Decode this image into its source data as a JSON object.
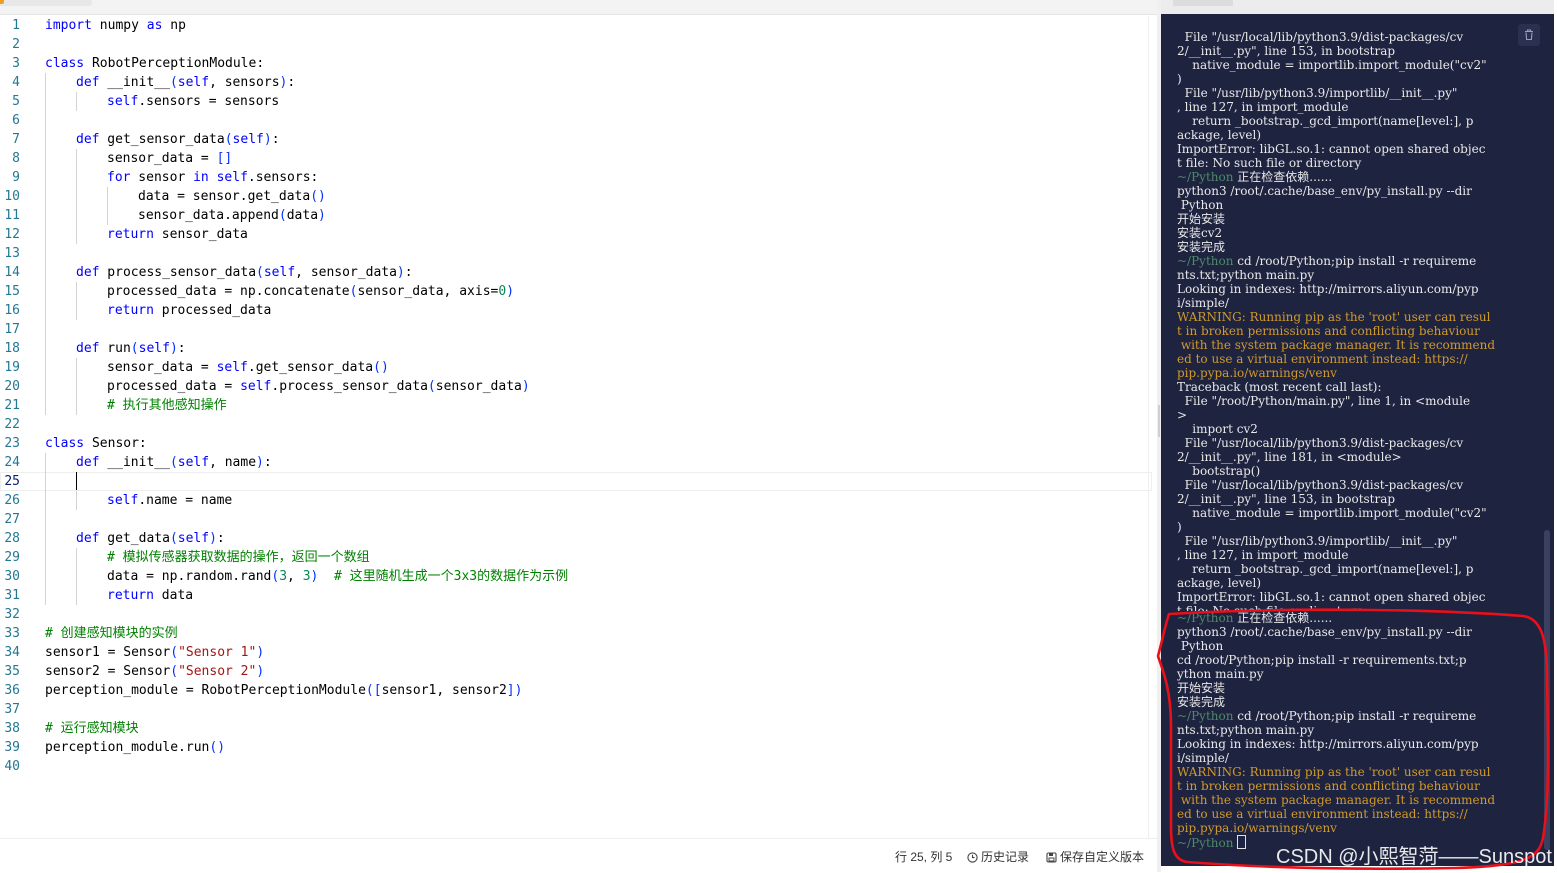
{
  "editor": {
    "cursor_line": 25,
    "lines": [
      {
        "n": "1",
        "indent": 0,
        "html": "<span class='kw'>import</span> numpy <span class='kw'>as</span> np"
      },
      {
        "n": "2",
        "indent": 0,
        "html": ""
      },
      {
        "n": "3",
        "indent": 0,
        "html": "<span class='kw'>class</span> RobotPerceptionModule:"
      },
      {
        "n": "4",
        "indent": 1,
        "html": "    <span class='kw'>def</span> __init__<span class='br'>(</span><span class='kw'>self</span>, sensors<span class='br'>)</span>:"
      },
      {
        "n": "5",
        "indent": 2,
        "html": "        <span class='kw'>self</span>.sensors = sensors"
      },
      {
        "n": "6",
        "indent": 1,
        "html": ""
      },
      {
        "n": "7",
        "indent": 1,
        "html": "    <span class='kw'>def</span> get_sensor_data<span class='br'>(</span><span class='kw'>self</span><span class='br'>)</span>:"
      },
      {
        "n": "8",
        "indent": 2,
        "html": "        sensor_data = <span class='br'>[]</span>"
      },
      {
        "n": "9",
        "indent": 2,
        "html": "        <span class='kw'>for</span> sensor <span class='kw'>in</span> <span class='kw'>self</span>.sensors:"
      },
      {
        "n": "10",
        "indent": 3,
        "html": "            data = sensor.get_data<span class='br'>()</span>"
      },
      {
        "n": "11",
        "indent": 3,
        "html": "            sensor_data.append<span class='br'>(</span>data<span class='br'>)</span>"
      },
      {
        "n": "12",
        "indent": 2,
        "html": "        <span class='kw'>return</span> sensor_data"
      },
      {
        "n": "13",
        "indent": 1,
        "html": ""
      },
      {
        "n": "14",
        "indent": 1,
        "html": "    <span class='kw'>def</span> process_sensor_data<span class='br'>(</span><span class='kw'>self</span>, sensor_data<span class='br'>)</span>:"
      },
      {
        "n": "15",
        "indent": 2,
        "html": "        processed_data = np.concatenate<span class='br'>(</span>sensor_data, axis=<span class='nm'>0</span><span class='br'>)</span>"
      },
      {
        "n": "16",
        "indent": 2,
        "html": "        <span class='kw'>return</span> processed_data"
      },
      {
        "n": "17",
        "indent": 1,
        "html": ""
      },
      {
        "n": "18",
        "indent": 1,
        "html": "    <span class='kw'>def</span> run<span class='br'>(</span><span class='kw'>self</span><span class='br'>)</span>:"
      },
      {
        "n": "19",
        "indent": 2,
        "html": "        sensor_data = <span class='kw'>self</span>.get_sensor_data<span class='br'>()</span>"
      },
      {
        "n": "20",
        "indent": 2,
        "html": "        processed_data = <span class='kw'>self</span>.process_sensor_data<span class='br'>(</span>sensor_data<span class='br'>)</span>"
      },
      {
        "n": "21",
        "indent": 2,
        "html": "        <span class='cm'># 执行其他感知操作</span>"
      },
      {
        "n": "22",
        "indent": 0,
        "html": ""
      },
      {
        "n": "23",
        "indent": 0,
        "html": "<span class='kw'>class</span> Sensor:"
      },
      {
        "n": "24",
        "indent": 1,
        "html": "    <span class='kw'>def</span> __init__<span class='br'>(</span><span class='kw'>self</span>, name<span class='br'>)</span>:"
      },
      {
        "n": "25",
        "indent": 1,
        "html": ""
      },
      {
        "n": "26",
        "indent": 2,
        "html": "        <span class='kw'>self</span>.name = name"
      },
      {
        "n": "27",
        "indent": 1,
        "html": ""
      },
      {
        "n": "28",
        "indent": 1,
        "html": "    <span class='kw'>def</span> get_data<span class='br'>(</span><span class='kw'>self</span><span class='br'>)</span>:"
      },
      {
        "n": "29",
        "indent": 2,
        "html": "        <span class='cm'># 模拟传感器获取数据的操作，返回一个数组</span>"
      },
      {
        "n": "30",
        "indent": 2,
        "html": "        data = np.random.rand<span class='br'>(</span><span class='nm'>3</span>, <span class='nm'>3</span><span class='br'>)</span>  <span class='cm'># 这里随机生成一个3x3的数据作为示例</span>"
      },
      {
        "n": "31",
        "indent": 2,
        "html": "        <span class='kw'>return</span> data"
      },
      {
        "n": "32",
        "indent": 0,
        "html": ""
      },
      {
        "n": "33",
        "indent": 0,
        "html": "<span class='cm'># 创建感知模块的实例</span>"
      },
      {
        "n": "34",
        "indent": 0,
        "html": "sensor1 = Sensor<span class='br'>(</span><span class='st'>\"Sensor 1\"</span><span class='br'>)</span>"
      },
      {
        "n": "35",
        "indent": 0,
        "html": "sensor2 = Sensor<span class='br'>(</span><span class='st'>\"Sensor 2\"</span><span class='br'>)</span>"
      },
      {
        "n": "36",
        "indent": 0,
        "html": "perception_module = RobotPerceptionModule<span class='br'>([</span>sensor1, sensor2<span class='br'>])</span>"
      },
      {
        "n": "37",
        "indent": 0,
        "html": ""
      },
      {
        "n": "38",
        "indent": 0,
        "html": "<span class='cm'># 运行感知模块</span>"
      },
      {
        "n": "39",
        "indent": 0,
        "html": "perception_module.run<span class='br'>()</span>"
      },
      {
        "n": "40",
        "indent": 0,
        "html": ""
      }
    ]
  },
  "status_bar": {
    "position": "行 25, 列 5",
    "history_label": "历史记录",
    "save_label": "保存自定义版本",
    "history_icon": "clock-icon",
    "save_icon": "save-icon"
  },
  "terminal": {
    "prompt": "~/Python",
    "lines": [
      {
        "t": "  File \"/usr/local/lib/python3.9/dist-packages/cv",
        "c": ""
      },
      {
        "t": "2/__init__.py\", line 153, in bootstrap",
        "c": ""
      },
      {
        "t": "    native_module = importlib.import_module(\"cv2\"",
        "c": ""
      },
      {
        "t": ")",
        "c": ""
      },
      {
        "t": "  File \"/usr/lib/python3.9/importlib/__init__.py\"",
        "c": ""
      },
      {
        "t": ", line 127, in import_module",
        "c": ""
      },
      {
        "t": "    return _bootstrap._gcd_import(name[level:], p",
        "c": ""
      },
      {
        "t": "ackage, level)",
        "c": ""
      },
      {
        "t": "ImportError: libGL.so.1: cannot open shared objec",
        "c": ""
      },
      {
        "t": "t file: No such file or directory",
        "c": ""
      },
      {
        "t": " 正在检查依赖......",
        "c": "prompt"
      },
      {
        "t": "python3 /root/.cache/base_env/py_install.py --dir",
        "c": ""
      },
      {
        "t": " Python",
        "c": ""
      },
      {
        "t": "开始安装",
        "c": ""
      },
      {
        "t": "安装cv2",
        "c": ""
      },
      {
        "t": "安装完成",
        "c": ""
      },
      {
        "t": " cd /root/Python;pip install -r requireme",
        "c": "prompt"
      },
      {
        "t": "nts.txt;python main.py",
        "c": ""
      },
      {
        "t": "Looking in indexes: http://mirrors.aliyun.com/pyp",
        "c": ""
      },
      {
        "t": "i/simple/",
        "c": ""
      },
      {
        "t": "WARNING: Running pip as the 'root' user can resul",
        "c": "warn"
      },
      {
        "t": "t in broken permissions and conflicting behaviour",
        "c": "warn"
      },
      {
        "t": " with the system package manager. It is recommend",
        "c": "warn"
      },
      {
        "t": "ed to use a virtual environment instead: https://",
        "c": "warn"
      },
      {
        "t": "pip.pypa.io/warnings/venv",
        "c": "warn"
      },
      {
        "t": "Traceback (most recent call last):",
        "c": ""
      },
      {
        "t": "  File \"/root/Python/main.py\", line 1, in <module",
        "c": ""
      },
      {
        "t": ">",
        "c": ""
      },
      {
        "t": "    import cv2",
        "c": ""
      },
      {
        "t": "  File \"/usr/local/lib/python3.9/dist-packages/cv",
        "c": ""
      },
      {
        "t": "2/__init__.py\", line 181, in <module>",
        "c": ""
      },
      {
        "t": "    bootstrap()",
        "c": ""
      },
      {
        "t": "  File \"/usr/local/lib/python3.9/dist-packages/cv",
        "c": ""
      },
      {
        "t": "2/__init__.py\", line 153, in bootstrap",
        "c": ""
      },
      {
        "t": "    native_module = importlib.import_module(\"cv2\"",
        "c": ""
      },
      {
        "t": ")",
        "c": ""
      },
      {
        "t": "  File \"/usr/lib/python3.9/importlib/__init__.py\"",
        "c": ""
      },
      {
        "t": ", line 127, in import_module",
        "c": ""
      },
      {
        "t": "    return _bootstrap._gcd_import(name[level:], p",
        "c": ""
      },
      {
        "t": "ackage, level)",
        "c": ""
      },
      {
        "t": "ImportError: libGL.so.1: cannot open shared objec",
        "c": ""
      },
      {
        "t": "t file: No such file or directory",
        "c": "partial"
      },
      {
        "t": " 正在检查依赖......",
        "c": "prompt"
      },
      {
        "t": "python3 /root/.cache/base_env/py_install.py --dir",
        "c": ""
      },
      {
        "t": " Python",
        "c": ""
      },
      {
        "t": "cd /root/Python;pip install -r requirements.txt;p",
        "c": ""
      },
      {
        "t": "ython main.py",
        "c": ""
      },
      {
        "t": "开始安装",
        "c": ""
      },
      {
        "t": "安装完成",
        "c": ""
      },
      {
        "t": " cd /root/Python;pip install -r requireme",
        "c": "prompt"
      },
      {
        "t": "nts.txt;python main.py",
        "c": ""
      },
      {
        "t": "Looking in indexes: http://mirrors.aliyun.com/pyp",
        "c": ""
      },
      {
        "t": "i/simple/",
        "c": ""
      },
      {
        "t": "WARNING: Running pip as the 'root' user can resul",
        "c": "warn"
      },
      {
        "t": "t in broken permissions and conflicting behaviour",
        "c": "warn"
      },
      {
        "t": " with the system package manager. It is recommend",
        "c": "warn"
      },
      {
        "t": "ed to use a virtual environment instead: https://",
        "c": "warn"
      },
      {
        "t": "pip.pypa.io/warnings/venv",
        "c": "warn"
      },
      {
        "t": "",
        "c": "prompt-cursor"
      }
    ],
    "trash_icon": "trash-icon"
  },
  "watermark": "CSDN @小熙智菏——Sunspot",
  "colors": {
    "terminal_bg": "#1e2340",
    "warning": "#d19a2c",
    "prompt": "#4f8a6a",
    "annotation": "#e8101a",
    "keyword": "#0000ff",
    "comment": "#008000",
    "string": "#a31515"
  }
}
